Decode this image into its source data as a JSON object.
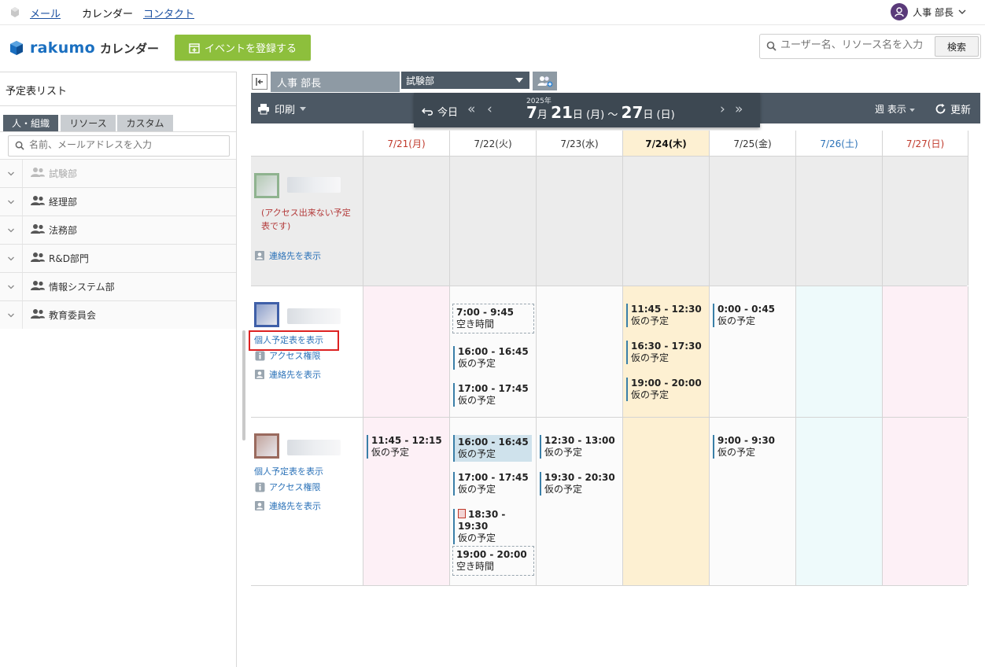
{
  "topnav": {
    "mail": "メール",
    "calendar": "カレンダー",
    "contact": "コンタクト",
    "user_name": "人事 部長"
  },
  "header": {
    "brand": "rakumo",
    "brand_sub": "カレンダー",
    "register_button": "イベントを登録する",
    "search_placeholder": "ユーザー名、リソース名を入力",
    "search_button": "検索"
  },
  "sidebar": {
    "title": "予定表リスト",
    "tabs": [
      "人・組織",
      "リソース",
      "カスタム"
    ],
    "search_placeholder": "名前、メールアドレスを入力",
    "groups": [
      {
        "label": "試験部",
        "muted": true
      },
      {
        "label": "経理部",
        "muted": false
      },
      {
        "label": "法務部",
        "muted": false
      },
      {
        "label": "R&D部門",
        "muted": false
      },
      {
        "label": "情報システム部",
        "muted": false
      },
      {
        "label": "教育委員会",
        "muted": false
      }
    ]
  },
  "toolbar": {
    "owner_tab": "人事 部長",
    "group_select": "試験部",
    "print": "印刷",
    "today": "今日",
    "year": "2025年",
    "range_month_start": "7",
    "range_day_start": "21",
    "range_dow_start": "(月)",
    "range_sep": "〜",
    "range_day_end": "27",
    "range_dow_end": "(日)",
    "month_suffix": "月",
    "day_suffix": "日",
    "view": "週 表示",
    "refresh": "更新"
  },
  "days": [
    {
      "label": "7/21(月)",
      "color": "#c0392b",
      "bg": "#fdf0f6"
    },
    {
      "label": "7/22(火)",
      "color": "#333333",
      "bg": "#fbfbfb"
    },
    {
      "label": "7/23(水)",
      "color": "#333333",
      "bg": "#fbfbfb"
    },
    {
      "label": "7/24(木)",
      "color": "#111111",
      "bg": "#fdf0d2",
      "bold": true
    },
    {
      "label": "7/25(金)",
      "color": "#333333",
      "bg": "#fbfbfb"
    },
    {
      "label": "7/26(土)",
      "color": "#2b72b8",
      "bg": "#eefafb"
    },
    {
      "label": "7/27(日)",
      "color": "#c0392b",
      "bg": "#fdf0f6"
    }
  ],
  "links": {
    "personal": "個人予定表を表示",
    "access": "アクセス権限",
    "contact": "連絡先を表示"
  },
  "rows": [
    {
      "avatar_color": "#8fb38f",
      "no_access": "(アクセス出来ない予定表です)",
      "links": [
        "contact"
      ],
      "events": {}
    },
    {
      "avatar_color": "#3f5fa8",
      "links": [
        "personal",
        "access",
        "contact"
      ],
      "events": {
        "1": [
          {
            "time": "7:00 - 9:45",
            "label": "空き時間",
            "kind": "free"
          },
          {
            "time": "16:00 - 16:45",
            "label": "仮の予定"
          },
          {
            "time": "17:00 - 17:45",
            "label": "仮の予定"
          }
        ],
        "3": [
          {
            "time": "11:45 - 12:30",
            "label": "仮の予定"
          },
          {
            "time": "16:30 - 17:30",
            "label": "仮の予定"
          },
          {
            "time": "19:00 - 20:00",
            "label": "仮の予定"
          }
        ],
        "4": [
          {
            "time": "0:00 - 0:45",
            "label": "仮の予定"
          }
        ]
      }
    },
    {
      "avatar_color": "#9a6a5e",
      "links": [
        "personal",
        "access",
        "contact"
      ],
      "events": {
        "0": [
          {
            "time": "11:45 - 12:15",
            "label": "仮の予定"
          }
        ],
        "1": [
          {
            "time": "16:00 - 16:45",
            "label": "仮の予定",
            "kind": "highlight"
          },
          {
            "time": "17:00 - 17:45",
            "label": "仮の予定"
          },
          {
            "time": "18:30 - 19:30",
            "label": "仮の予定",
            "icon": true
          },
          {
            "time": "19:00 - 20:00",
            "label": "空き時間",
            "kind": "free"
          }
        ],
        "2": [
          {
            "time": "12:30 - 13:00",
            "label": "仮の予定"
          },
          {
            "time": "19:30 - 20:30",
            "label": "仮の予定"
          }
        ],
        "4": [
          {
            "time": "9:00 - 9:30",
            "label": "仮の予定"
          }
        ]
      }
    }
  ]
}
